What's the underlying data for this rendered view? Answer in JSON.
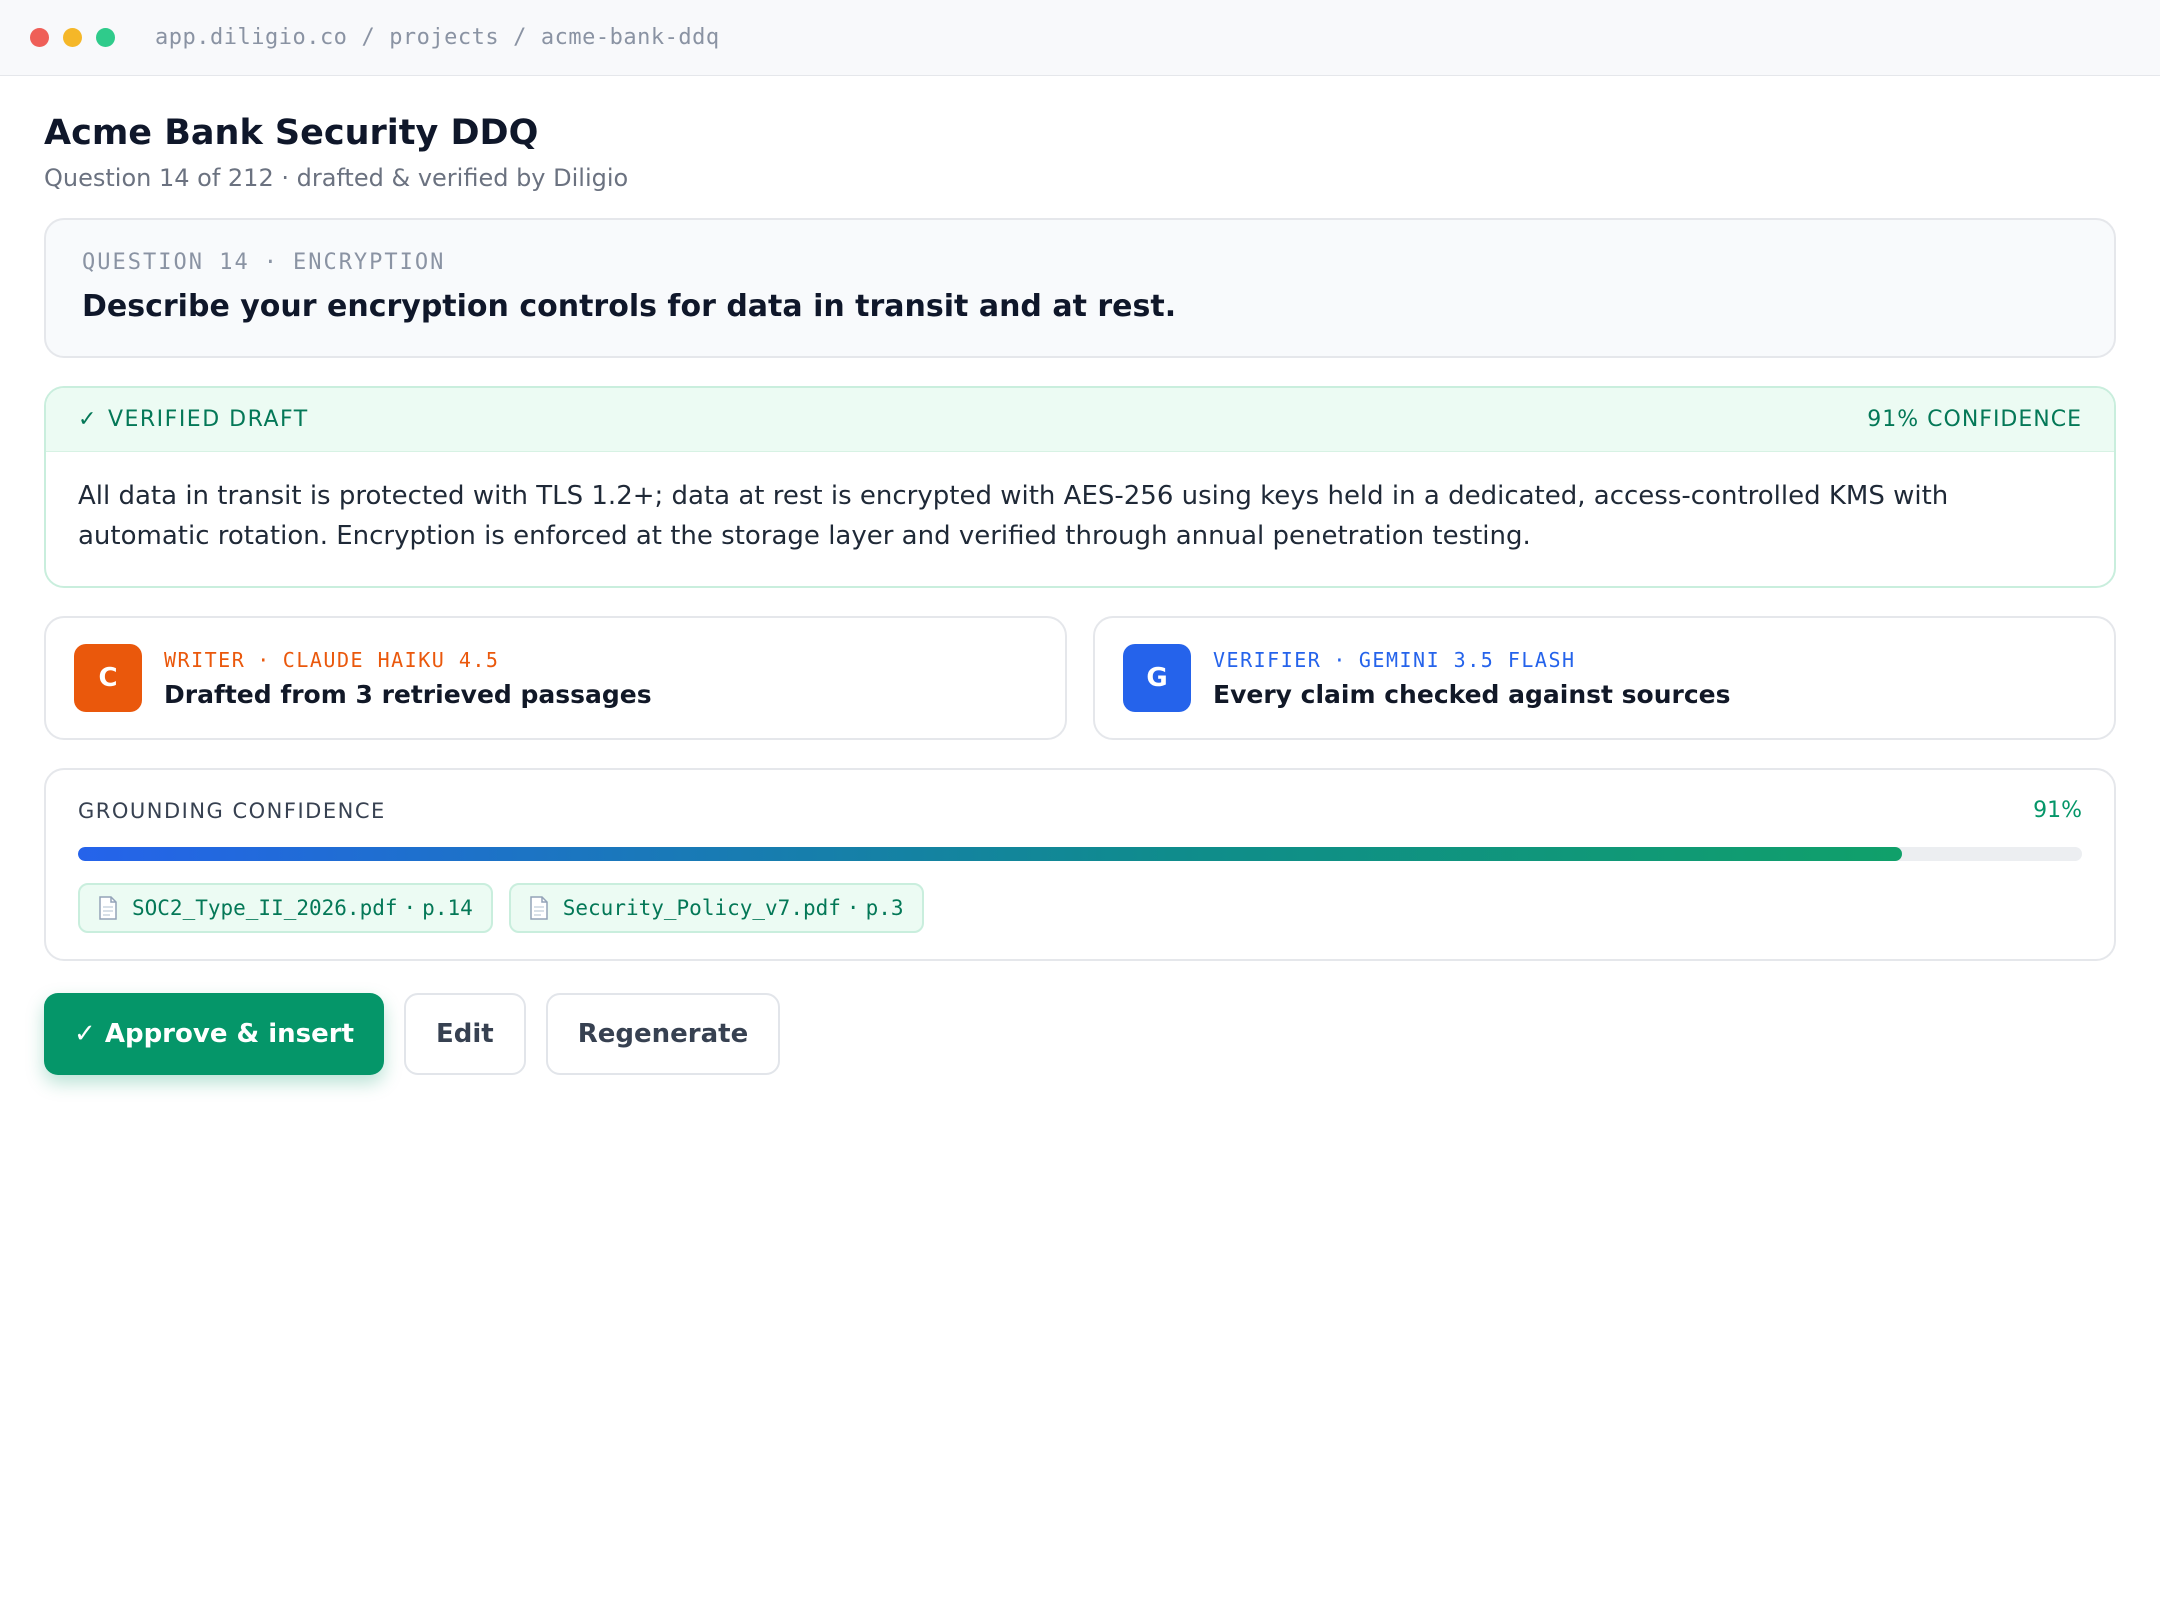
{
  "browser": {
    "breadcrumb": [
      "app.diligio.co",
      "projects",
      "acme-bank-ddq"
    ],
    "breadcrumb_separator": "/"
  },
  "page": {
    "title": "Acme Bank Security DDQ",
    "subtitle": "Question 14 of 212 · drafted & verified by Diligio"
  },
  "question": {
    "label": "QUESTION 14",
    "category": "ENCRYPTION",
    "separator": "·",
    "text": "Describe your encryption controls for data in transit and at rest."
  },
  "draft": {
    "check_glyph": "✓",
    "status": "VERIFIED DRAFT",
    "confidence_value": "91%",
    "confidence_label": "CONFIDENCE",
    "body": "All data in transit is protected with TLS 1.2+; data at rest is encrypted with AES-256 using keys held in a dedicated, access-controlled KMS with automatic rotation. Encryption is enforced at the storage layer and verified through annual penetration testing."
  },
  "models": [
    {
      "avatar": "C",
      "role": "WRITER",
      "model": "CLAUDE HAIKU 4.5",
      "description": "Drafted from 3 retrieved passages",
      "color": "#ea580c"
    },
    {
      "avatar": "G",
      "role": "VERIFIER",
      "model": "GEMINI 3.5 FLASH",
      "description": "Every claim checked against sources",
      "color": "#2563eb"
    }
  ],
  "grounding": {
    "label": "GROUNDING CONFIDENCE",
    "value_text": "91%",
    "value": 0.91,
    "sources": [
      {
        "file": "SOC2_Type_II_2026.pdf",
        "page": "p.14",
        "icon": "document-icon"
      },
      {
        "file": "Security_Policy_v7.pdf",
        "page": "p.3",
        "icon": "document-icon"
      }
    ]
  },
  "actions": {
    "approve_label": "✓ Approve & insert",
    "edit_label": "Edit",
    "regenerate_label": "Regenerate"
  },
  "colors": {
    "traffic_red": "#ef5f58",
    "traffic_yellow": "#f5b728",
    "traffic_green": "#2fcb8b",
    "accent_green": "#059669",
    "verified_bg": "#ecfbf3"
  }
}
